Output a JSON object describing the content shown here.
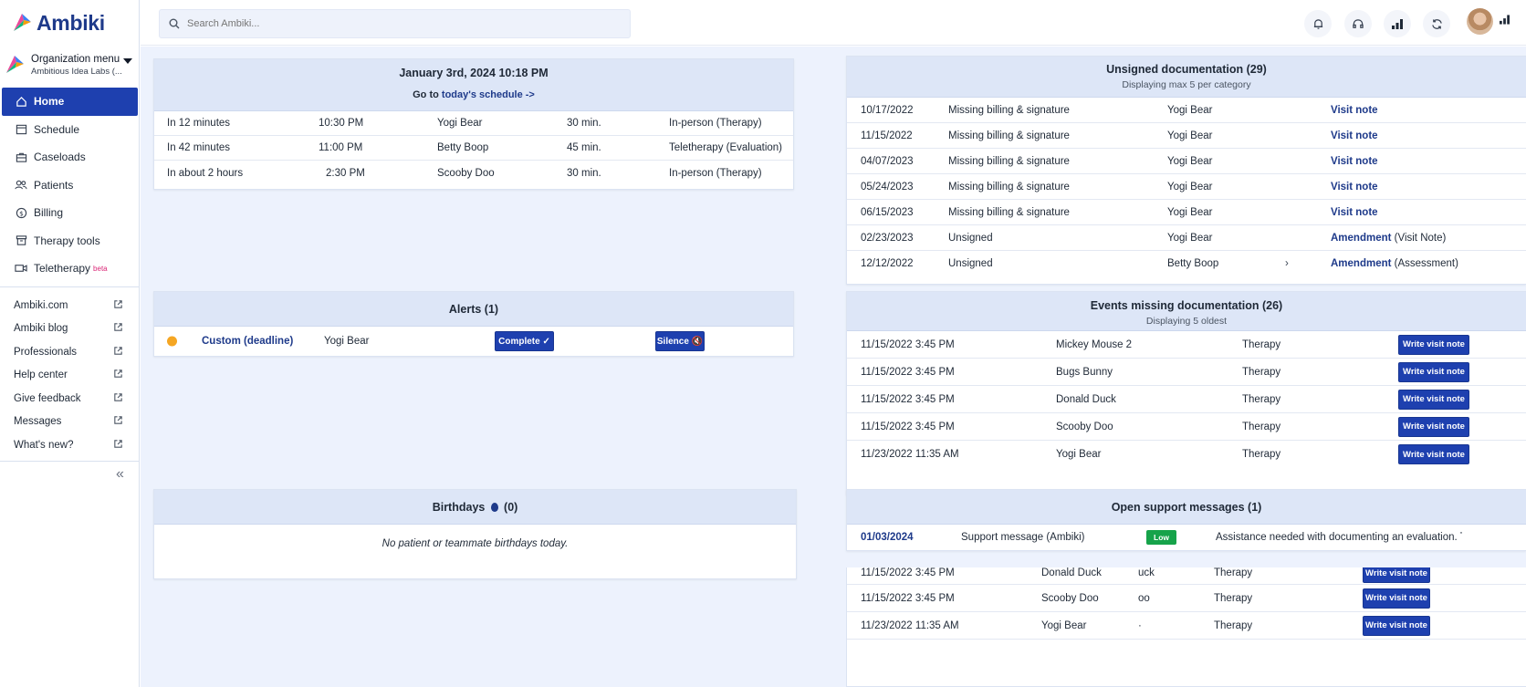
{
  "app": {
    "name": "Ambiki"
  },
  "colors": {
    "accent": "#1e40af",
    "brand": "#1e3a8a",
    "low": "#16a34a",
    "alert_dot": "#f5a623"
  },
  "org": {
    "title": "Organization menu",
    "subtitle": "Ambitious Idea Labs (..."
  },
  "nav": [
    {
      "label": "Home",
      "icon": "home-icon",
      "active": true
    },
    {
      "label": "Schedule",
      "icon": "calendar-icon"
    },
    {
      "label": "Caseloads",
      "icon": "briefcase-icon"
    },
    {
      "label": "Patients",
      "icon": "users-icon"
    },
    {
      "label": "Billing",
      "icon": "dollar-icon"
    },
    {
      "label": "Therapy tools",
      "icon": "archive-icon"
    },
    {
      "label": "Teletherapy",
      "icon": "video-icon",
      "badge": "beta"
    }
  ],
  "links": [
    "Ambiki.com",
    "Ambiki blog",
    "Professionals",
    "Help center",
    "Give feedback",
    "Messages",
    "What's new?"
  ],
  "search": {
    "placeholder": "Search Ambiki..."
  },
  "schedule": {
    "title": "January 3rd, 2024 10:18 PM",
    "goto_prefix": "Go to",
    "goto_link": "today's schedule ->",
    "rows": [
      {
        "when": "In 12 minutes",
        "time": "10:30 PM",
        "patient": "Yogi Bear",
        "duration": "30 min.",
        "type": "In-person (Therapy)"
      },
      {
        "when": "In 42 minutes",
        "time": "11:00 PM",
        "patient": "Betty Boop",
        "duration": "45 min.",
        "type": "Teletherapy (Evaluation)"
      },
      {
        "when": "In about 2 hours",
        "time": "2:30 PM",
        "patient": "Scooby Doo",
        "duration": "30 min.",
        "type": "In-person (Therapy)"
      }
    ]
  },
  "unsigned": {
    "title": "Unsigned documentation (29)",
    "subtitle": "Displaying max 5 per category",
    "rows": [
      {
        "date": "10/17/2022",
        "status": "Missing billing & signature",
        "patient": "Yogi Bear",
        "doc": "Visit note",
        "detail": ""
      },
      {
        "date": "11/15/2022",
        "status": "Missing billing & signature",
        "patient": "Yogi Bear",
        "doc": "Visit note",
        "detail": ""
      },
      {
        "date": "04/07/2023",
        "status": "Missing billing & signature",
        "patient": "Yogi Bear",
        "doc": "Visit note",
        "detail": ""
      },
      {
        "date": "05/24/2023",
        "status": "Missing billing & signature",
        "patient": "Yogi Bear",
        "doc": "Visit note",
        "detail": ""
      },
      {
        "date": "06/15/2023",
        "status": "Missing billing & signature",
        "patient": "Yogi Bear",
        "doc": "Visit note",
        "detail": ""
      },
      {
        "date": "02/23/2023",
        "status": "Unsigned",
        "patient": "Yogi Bear",
        "doc": "Amendment",
        "detail": "(Visit Note)"
      },
      {
        "date": "12/12/2022",
        "status": "Unsigned",
        "patient": "Betty Boop",
        "doc": "Amendment",
        "detail": "(Assessment)"
      }
    ]
  },
  "alerts": {
    "title": "Alerts (1)",
    "row": {
      "name": "Custom (deadline)",
      "patient": "Yogi Bear",
      "complete": "Complete ✓",
      "silence": "Silence 🔇"
    }
  },
  "events": {
    "title": "Events missing documentation (26)",
    "subtitle": "Displaying 5 oldest",
    "button": "Write visit note",
    "rows": [
      {
        "date": "11/15/2022 3:45 PM",
        "patient": "Mickey Mouse 2",
        "type": "Therapy"
      },
      {
        "date": "11/15/2022 3:45 PM",
        "patient": "Bugs Bunny",
        "type": "Therapy"
      },
      {
        "date": "11/15/2022 3:45 PM",
        "patient": "Donald Duck",
        "type": "Therapy"
      },
      {
        "date": "11/15/2022 3:45 PM",
        "patient": "Scooby Doo",
        "type": "Therapy"
      },
      {
        "date": "11/23/2022 11:35 AM",
        "patient": "Yogi Bear",
        "type": "Therapy"
      }
    ]
  },
  "birthdays": {
    "title": "Birthdays",
    "count": "(0)",
    "empty": "No patient or teammate birthdays today."
  },
  "support": {
    "title": "Open support messages (1)",
    "row": {
      "date": "01/03/2024",
      "subject": "Support message (Ambiki)",
      "priority": "Low",
      "preview": "Assistance needed with documenting an evaluation. Testi"
    }
  },
  "ghost_events": {
    "button": "Write visit note",
    "rows": [
      {
        "date": "11/15/2022 3:45 PM",
        "patient": "Donald Duck",
        "frag": "uck",
        "type": "Therapy"
      },
      {
        "date": "11/15/2022 3:45 PM",
        "patient": "Scooby Doo",
        "frag": "oo",
        "type": "Therapy"
      },
      {
        "date": "11/23/2022 11:35 AM",
        "patient": "Yogi Bear",
        "frag": "·",
        "type": "Therapy"
      }
    ]
  }
}
